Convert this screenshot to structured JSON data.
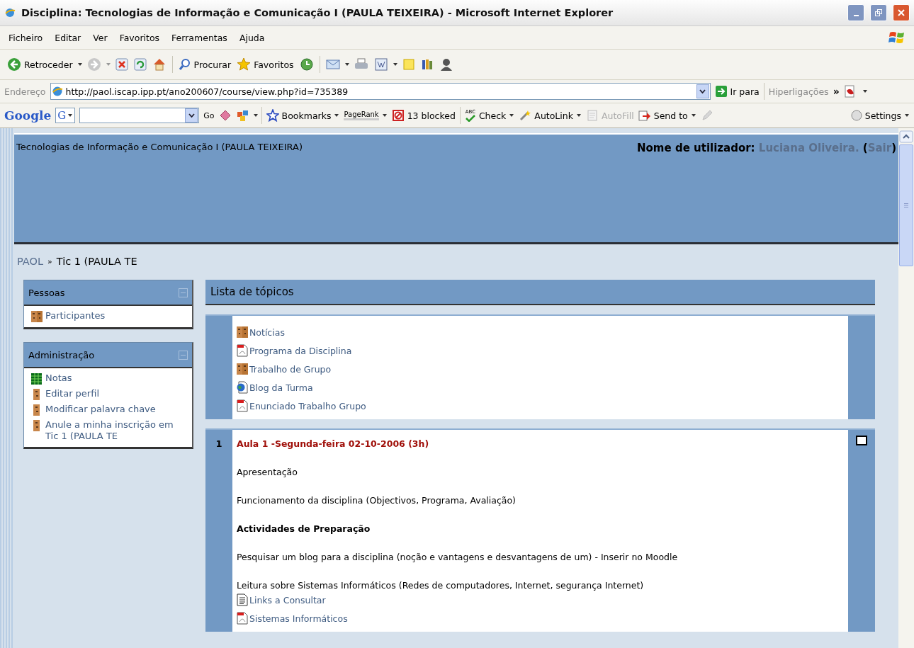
{
  "window": {
    "title": "Disciplina: Tecnologias de Informação e Comunicação I (PAULA TEIXEIRA) - Microsoft Internet Explorer"
  },
  "menu": [
    "Ficheiro",
    "Editar",
    "Ver",
    "Favoritos",
    "Ferramentas",
    "Ajuda"
  ],
  "toolbar": {
    "back": "Retroceder",
    "search": "Procurar",
    "favorites": "Favoritos"
  },
  "address": {
    "label": "Endereço",
    "url": "http://paol.iscap.ipp.pt/ano200607/course/view.php?id=735389",
    "go": "Ir para",
    "links": "Hiperligações",
    "chevron": "»"
  },
  "google_bar": {
    "logo": "Google",
    "g": "G",
    "go": "Go",
    "bookmarks": "Bookmarks",
    "pagerank": "PageRank",
    "blocked": "13 blocked",
    "check": "Check",
    "check_mark": "ABC",
    "autolink": "AutoLink",
    "autofill": "AutoFill",
    "autofill_disabled": true,
    "send_to": "Send to",
    "settings": "Settings"
  },
  "page": {
    "course_title": "Tecnologias de Informação e Comunicação I (PAULA TEIXEIRA)",
    "login": {
      "prefix": "Nome de utilizador: ",
      "name": "Luciana Oliveira.",
      "middle": " (",
      "logout": "Sair",
      "suffix": ")"
    },
    "breadcrumb": {
      "home": "PAOL",
      "separator": "»",
      "current": "Tic 1 (PAULA TE"
    },
    "blocks": [
      {
        "title": "Pessoas",
        "items": [
          {
            "kind": "people",
            "label": "Participantes"
          }
        ]
      },
      {
        "title": "Administração",
        "items": [
          {
            "kind": "grades",
            "label": "Notas"
          },
          {
            "kind": "person",
            "label": "Editar perfil"
          },
          {
            "kind": "person",
            "label": "Modificar palavra chave"
          },
          {
            "kind": "person",
            "label": "Anule a minha inscrição em Tic 1 (PAULA TE"
          }
        ]
      }
    ],
    "topics_title": "Lista de tópicos",
    "sections": [
      {
        "items": [
          {
            "kind": "people",
            "label": "Notícias"
          },
          {
            "kind": "pdf",
            "label": "Programa da Disciplina"
          },
          {
            "kind": "people",
            "label": "Trabalho de Grupo"
          },
          {
            "kind": "blog",
            "label": "Blog da Turma"
          },
          {
            "kind": "pdf",
            "label": "Enunciado Trabalho Grupo"
          }
        ]
      },
      {
        "number": "1",
        "items": [
          {
            "kind": "title",
            "label": "Aula 1 -Segunda-feira 02-10-2006 (3h)"
          },
          {
            "kind": "text",
            "label": "Apresentação"
          },
          {
            "kind": "text",
            "label": "Funcionamento da disciplina (Objectivos, Programa, Avaliação)"
          },
          {
            "kind": "heading",
            "label": "Actividades de Preparação"
          },
          {
            "kind": "text",
            "label": "Pesquisar um blog para a disciplina (noção e vantagens e desvantagens de um) - Inserir no Moodle"
          },
          {
            "kind": "text",
            "label": "Leitura sobre Sistemas Informáticos (Redes de computadores, Internet, segurança Internet)"
          },
          {
            "kind": "doc",
            "label": "Links a Consultar"
          },
          {
            "kind": "pdf",
            "label": "Sistemas Informáticos"
          }
        ]
      }
    ]
  }
}
